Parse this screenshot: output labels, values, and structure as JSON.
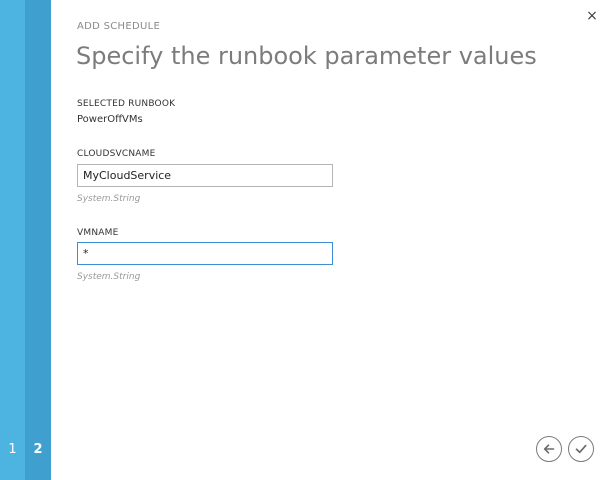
{
  "steps": [
    {
      "number": "1"
    },
    {
      "number": "2"
    }
  ],
  "dialog": {
    "eyebrow": "ADD SCHEDULE",
    "title": "Specify the runbook parameter values",
    "close_glyph": "×"
  },
  "selected_runbook": {
    "label": "SELECTED RUNBOOK",
    "value": "PowerOffVMs"
  },
  "params": [
    {
      "label": "CLOUDSVCNAME",
      "value": "MyCloudService",
      "type": "System.String"
    },
    {
      "label": "VMNAME",
      "value": "*",
      "type": "System.String"
    }
  ],
  "colors": {
    "step1": "#4db3e0",
    "step2": "#3f9fcf",
    "focus_border": "#3d8ed6"
  },
  "icons": {
    "back": "arrow-left-icon",
    "ok": "checkmark-icon",
    "close": "close-icon"
  }
}
